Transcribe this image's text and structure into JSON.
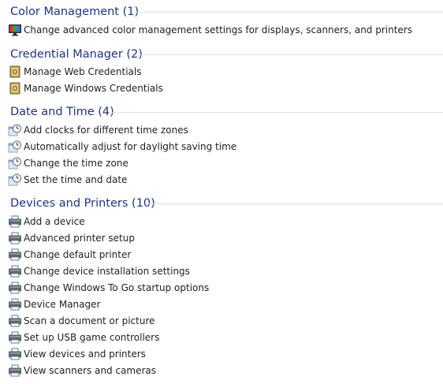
{
  "groups": [
    {
      "title": "Color Management (1)",
      "items": [
        {
          "label": "Change advanced color management settings for displays, scanners, and printers",
          "icon": "monitor-color-icon"
        }
      ]
    },
    {
      "title": "Credential Manager (2)",
      "items": [
        {
          "label": "Manage Web Credentials",
          "icon": "credential-vault-icon"
        },
        {
          "label": "Manage Windows Credentials",
          "icon": "credential-vault-icon"
        }
      ]
    },
    {
      "title": "Date and Time (4)",
      "items": [
        {
          "label": "Add clocks for different time zones",
          "icon": "clock-calendar-icon"
        },
        {
          "label": "Automatically adjust for daylight saving time",
          "icon": "clock-calendar-icon"
        },
        {
          "label": "Change the time zone",
          "icon": "clock-calendar-icon"
        },
        {
          "label": "Set the time and date",
          "icon": "clock-calendar-icon"
        }
      ]
    },
    {
      "title": "Devices and Printers (10)",
      "items": [
        {
          "label": "Add a device",
          "icon": "devices-printer-icon"
        },
        {
          "label": "Advanced printer setup",
          "icon": "devices-printer-icon"
        },
        {
          "label": "Change default printer",
          "icon": "devices-printer-icon"
        },
        {
          "label": "Change device installation settings",
          "icon": "devices-printer-icon"
        },
        {
          "label": "Change Windows To Go startup options",
          "icon": "devices-printer-icon"
        },
        {
          "label": "Device Manager",
          "icon": "devices-printer-icon"
        },
        {
          "label": "Scan a document or picture",
          "icon": "devices-printer-icon"
        },
        {
          "label": "Set up USB game controllers",
          "icon": "devices-printer-icon"
        },
        {
          "label": "View devices and printers",
          "icon": "devices-printer-icon"
        },
        {
          "label": "View scanners and cameras",
          "icon": "devices-printer-icon"
        }
      ]
    }
  ],
  "colors": {
    "heading": "#1e3287",
    "text": "#1e1e1e",
    "divider": "#e2e2e2",
    "background": "#ffffff"
  }
}
